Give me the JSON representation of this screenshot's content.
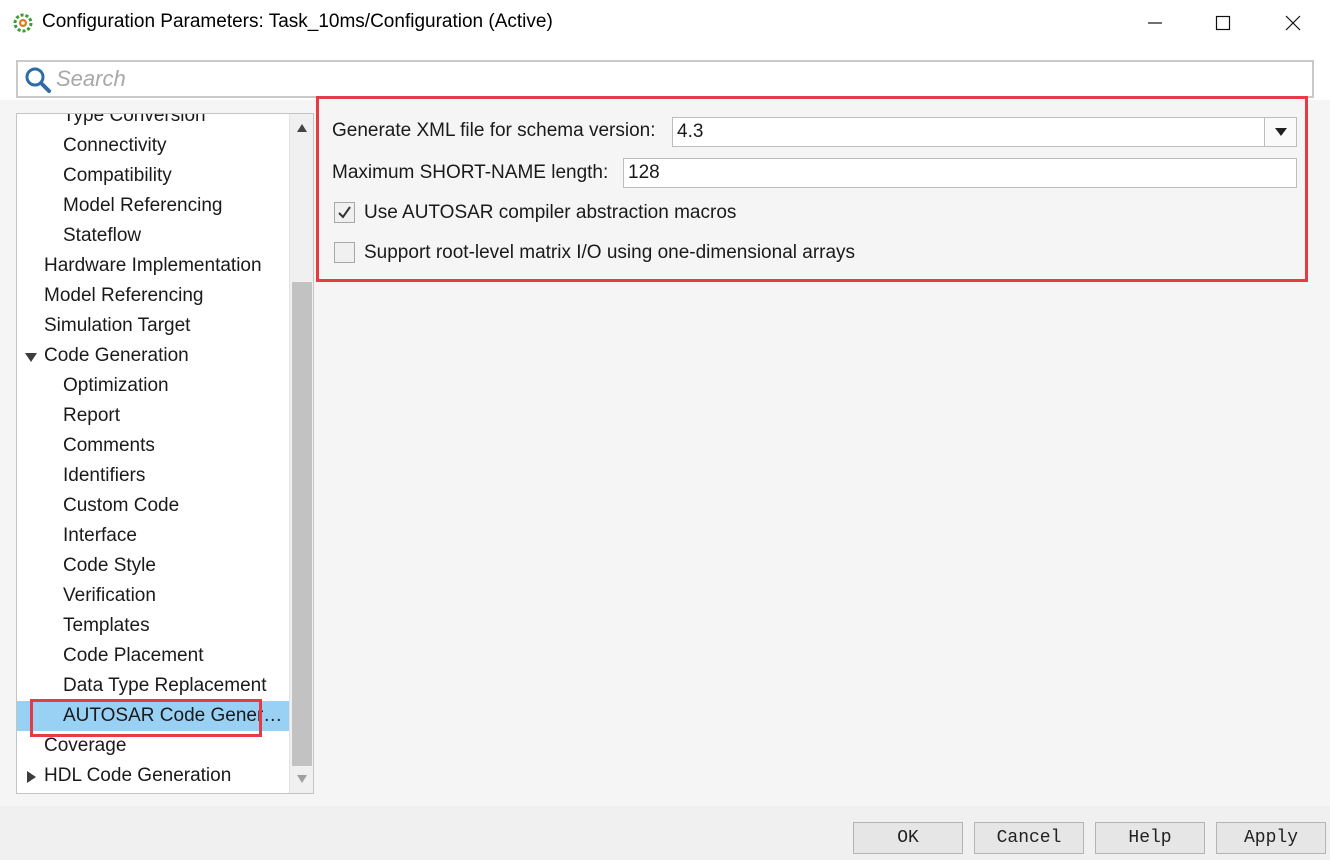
{
  "window": {
    "title": "Configuration Parameters: Task_10ms/Configuration (Active)"
  },
  "search": {
    "placeholder": "Search",
    "value": ""
  },
  "tree": {
    "items": [
      {
        "label": "Type Conversion",
        "level": 2
      },
      {
        "label": "Connectivity",
        "level": 2
      },
      {
        "label": "Compatibility",
        "level": 2
      },
      {
        "label": "Model Referencing",
        "level": 2
      },
      {
        "label": "Stateflow",
        "level": 2
      },
      {
        "label": "Hardware Implementation",
        "level": 1
      },
      {
        "label": "Model Referencing",
        "level": 1
      },
      {
        "label": "Simulation Target",
        "level": 1
      },
      {
        "label": "Code Generation",
        "level": 1,
        "expander": "expanded"
      },
      {
        "label": "Optimization",
        "level": 2
      },
      {
        "label": "Report",
        "level": 2
      },
      {
        "label": "Comments",
        "level": 2
      },
      {
        "label": "Identifiers",
        "level": 2
      },
      {
        "label": "Custom Code",
        "level": 2
      },
      {
        "label": "Interface",
        "level": 2
      },
      {
        "label": "Code Style",
        "level": 2
      },
      {
        "label": "Verification",
        "level": 2
      },
      {
        "label": "Templates",
        "level": 2
      },
      {
        "label": "Code Placement",
        "level": 2
      },
      {
        "label": "Data Type Replacement",
        "level": 2
      },
      {
        "label": "AUTOSAR Code Generation Options",
        "level": 2,
        "selected": true
      },
      {
        "label": "Coverage",
        "level": 1
      },
      {
        "label": "HDL Code Generation",
        "level": 1,
        "expander": "collapsed"
      }
    ]
  },
  "settings": {
    "schema_label": "Generate XML file for schema version:",
    "schema_value": "4.3",
    "short_name_label": "Maximum SHORT-NAME length:",
    "short_name_value": "128",
    "compiler_macros_label": "Use AUTOSAR compiler abstraction macros",
    "compiler_macros_checked": true,
    "matrix_io_label": "Support root-level matrix I/O using one-dimensional arrays",
    "matrix_io_checked": false
  },
  "buttons": {
    "ok": "OK",
    "cancel": "Cancel",
    "help": "Help",
    "apply": "Apply"
  },
  "colors": {
    "highlight": "#e63a44",
    "selection": "#99d1f5"
  }
}
